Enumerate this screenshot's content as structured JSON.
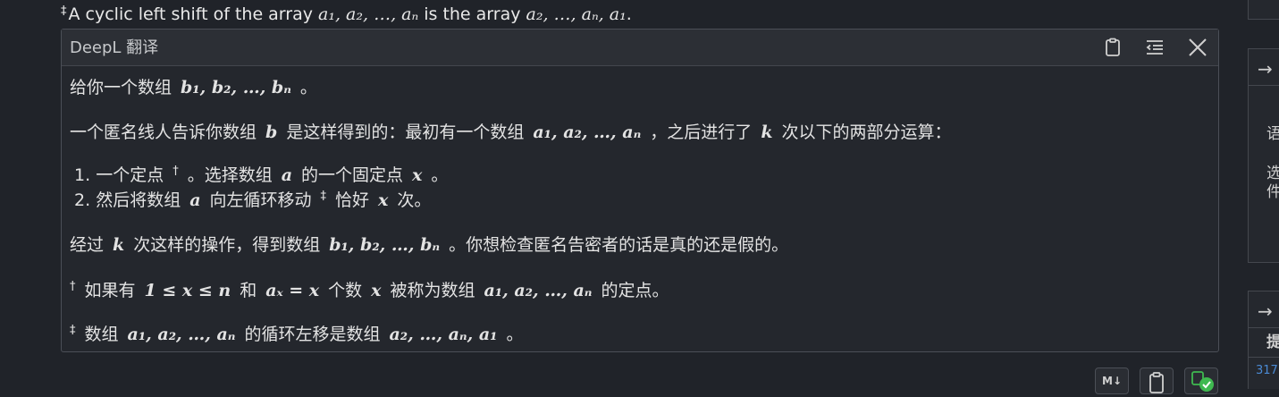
{
  "top_note": {
    "dagger": "‡",
    "text_before": "A cyclic left shift of the array ",
    "math1": "a₁, a₂, …, aₙ",
    "text_mid": " is the array ",
    "math2": "a₂, …, aₙ, a₁",
    "text_end": "."
  },
  "panel": {
    "title": "DeepL 翻译",
    "icons": [
      "clipboard-icon",
      "format-list-icon",
      "close-icon"
    ]
  },
  "content": {
    "p1_text": "给你一个数组",
    "p1_math": "b₁, b₂, …, bₙ",
    "p1_end": "。",
    "p2_a": "一个匿名线人告诉你数组",
    "p2_m1": "b",
    "p2_b": "是这样得到的：最初有一个数组",
    "p2_m2": "a₁, a₂, …, aₙ",
    "p2_c": "，之后进行了",
    "p2_m3": "k",
    "p2_d": "次以下的两部分运算：",
    "li1_num": "1.",
    "li1_a": "一个定点",
    "li1_sup": "†",
    "li1_b": "。选择数组",
    "li1_m1": "a",
    "li1_c": "的一个固定点",
    "li1_m2": "x",
    "li1_d": "。",
    "li2_num": "2.",
    "li2_a": "然后将数组",
    "li2_m1": "a",
    "li2_b": "向左循环移动",
    "li2_sup": "‡",
    "li2_c": "恰好",
    "li2_m2": "x",
    "li2_d": "次。",
    "p3_a": "经过",
    "p3_m1": "k",
    "p3_b": "次这样的操作，得到数组",
    "p3_m2": "b₁, b₂, …, bₙ",
    "p3_c": "。你想检查匿名告密者的话是真的还是假的。",
    "n1_sup": "†",
    "n1_a": "如果有",
    "n1_m1": "1 ≤ x ≤ n",
    "n1_b": "和",
    "n1_m2": "aₓ = x",
    "n1_c": "个数",
    "n1_m3": "x",
    "n1_d": "被称为数组",
    "n1_m4": "a₁, a₂, …, aₙ",
    "n1_e": "的定点。",
    "n2_sup": "‡",
    "n2_a": "数组",
    "n2_m1": "a₁, a₂, …, aₙ",
    "n2_b": "的循环左移是数组",
    "n2_m2": "a₂, …, aₙ, a₁",
    "n2_c": "。"
  },
  "right_strip": {
    "arrow1": "→",
    "char1": "语",
    "char2": "选",
    "char3": "件",
    "arrow2": "→",
    "char4": "提",
    "num": "317"
  },
  "bottom_buttons": {
    "markdown_label": "M↓"
  },
  "colors": {
    "background": "#202329",
    "panel": "#24272d",
    "header": "#2c2f35",
    "border": "#4b4f57",
    "text": "#e3e3e3",
    "accent_green": "#3fb950",
    "link_blue": "#4a8ad4"
  }
}
